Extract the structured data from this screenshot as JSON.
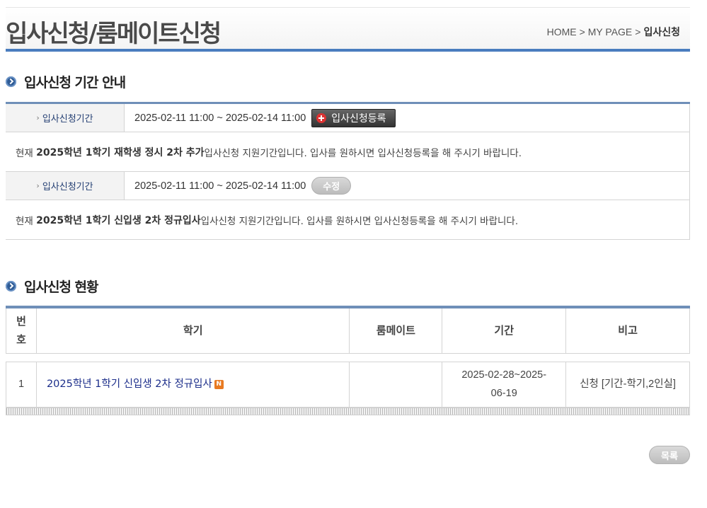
{
  "header": {
    "title": "입사신청/룸메이트신청",
    "breadcrumb": [
      "HOME",
      "MY PAGE",
      "입사신청"
    ],
    "separator": ">"
  },
  "section1": {
    "title": "입사신청 기간 안내",
    "rows": [
      {
        "label": "입사신청기간",
        "period": "2025-02-11 11:00 ~ 2025-02-14 11:00",
        "button": "입사신청등록",
        "desc_prefix": "현재 ",
        "desc_bold": "2025학년 1학기 재학생 정시 2차 추가",
        "desc_suffix": " 입사신청 지원기간입니다. 입사를 원하시면 입사신청등록을 해 주시기 바랍니다."
      },
      {
        "label": "입사신청기간",
        "period": "2025-02-11 11:00 ~ 2025-02-14 11:00",
        "button": "수정",
        "desc_prefix": "현재 ",
        "desc_bold": "2025학년 1학기 신입생 2차 정규입사",
        "desc_suffix": " 입사신청 지원기간입니다. 입사를 원하시면 입사신청등록을 해 주시기 바랍니다."
      }
    ]
  },
  "section2": {
    "title": "입사신청 현황",
    "columns": {
      "num_line1": "번",
      "num_line2": "호",
      "semester": "학기",
      "roommate": "룸메이트",
      "period": "기간",
      "note": "비고"
    },
    "rows": [
      {
        "num": "1",
        "semester": "2025학년 1학기 신입생 2차 정규입사",
        "new_badge": "N",
        "roommate": "",
        "period_line1": "2025-02-28~2025-",
        "period_line2": "06-19",
        "note": "신청 [기간-학기,2인실]"
      }
    ]
  },
  "footer": {
    "list_button": "목록"
  },
  "colors": {
    "accent": "#4a7dbf",
    "link": "#1b2d8a",
    "new_badge": "#e87a22"
  }
}
